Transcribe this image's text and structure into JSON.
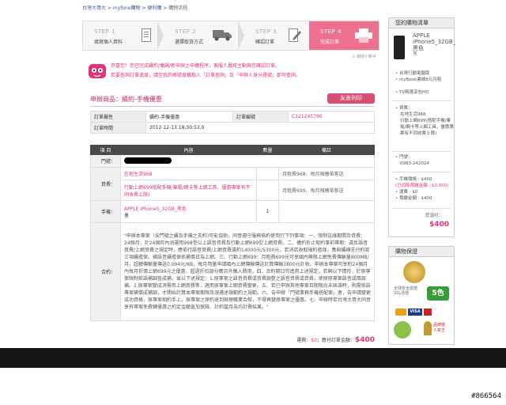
{
  "breadcrumb": {
    "home": "台灣大哥大",
    "myfone": "myfone購物",
    "shopping": "便利購",
    "current": "購物流程",
    "sep": " > "
  },
  "steps": [
    {
      "num": "STEP 1",
      "label": "填寫個人資料"
    },
    {
      "num": "STEP 2",
      "label": "選擇取貨方式"
    },
    {
      "num": "STEP 3",
      "label": "確認訂單"
    },
    {
      "num": "STEP 4",
      "label": "完成訂單"
    }
  ],
  "confirm": {
    "line1": "恭喜您！您已完成續約/攜碼/新申辦之申購程序，客服人員將主動與您確認訂單。",
    "line2": "若要查詢訂單進度，請至我的帳號頁籤點入「訂單查詢」及「申辦人身分證號」即可查詢。",
    "close": "關閉小幫手"
  },
  "apply": {
    "title": "申辦商品：續約-手機優惠",
    "print": "友善列印"
  },
  "info": {
    "type_label": "訂單屬性",
    "type_value": "續約-手機優惠",
    "num_label": "訂單編號",
    "num_value": "C121245796",
    "time_label": "訂單時間",
    "time_value": "2012-12-13 18:30:53.0"
  },
  "detail": {
    "headers": [
      "項 目",
      "內容",
      "數量",
      "備註"
    ],
    "door_label": "門號：",
    "fee_label": "資費：",
    "fee_plan1": "在地生活968",
    "fee_note1": "月租費968、每月預繳單客送",
    "fee_plan2": "行動上網699搭配手機/筆電/網卡等上網工具，優惠專案有不同收費上限)",
    "fee_note2": "月租費699、每月預繳單客送",
    "phone_label": "手機：",
    "phone_name": "APPLE iPhone5_32GB_黑色",
    "phone_color": "黑",
    "phone_qty": "1",
    "contract_label": "合約：",
    "contract_text": "\"申辦本專案（含門號之續及手機之支約)可能協助，同意遵守服務條約使用行下列事項：一、限制這綠期間及資費：24個月；計24個月內消運用968型以上語音資費及行動上網699型上網資費。二、權約折止契約事前專期：違反語音資費/上網資費之規定時，應依行語音資費/上網資費違約14000元/5300元，若消店收取綠約擔保，應與續補支付約款三項續擔保。補語音續擔保依補償日為上網。三、行動上網699：月租費699元可享國內無限上網免費傳輸量800MB/月，超額傳輸量傳送0.004元/KB，每月用量申請國內上網傳輸傳送計算傳輸1800元計收。申辦本專案可享約24個月內每月折價上網699元之優惠，超過折扣部分應另外繳入費用，四、合約期日完進用上述規定，若無以下情形，於原專案限制依語補調查成補，並以下述規定：1.原專案之語音資費或資費調整之語音資費或資費，使原原專案語音或價調補。2.原專案變成消需用上網資費等，適用原專案上網資費變更。五、若已申辦其他專案且期限尚未屆滿時，則需依該專案補償成補調，才開始計算本專案期限及須遵述規範約之規範。六、告申辦「門號業務手機搭配案」者，告申請變更成功資格，原專案相約手上，原專案之原約退到辦理職業合館，不得再變原專案之優惠。七、申辦時若台灣大哥大同意享有專案免費轉優惠之約定金額直加保險、計約當月為均計費結果。\""
  },
  "total": {
    "fee_label": "運費：",
    "fee": "$0",
    "order_label": "；應付訂單金額：",
    "amount": "$400"
  },
  "cart": {
    "title": "您的購物清單",
    "phone_name": "APPLE iPhone5_32GB_黑色",
    "phone_color": "黑",
    "gifts": [
      "台灣行動電腦版",
      "myBook書城8元月租",
      "TV精選享包HD"
    ],
    "plan_label": "資費：",
    "plan1": "在地生活968",
    "plan2": "行動上網699(搭配手機/筆電/網卡等上網工具，優惠專案有不同收費上限)",
    "door_label": "門號：",
    "door": "0983-242024",
    "phone_price_label": "手機價格",
    "phone_price": "$400",
    "discount_label": "(已扣除預繳金額",
    "discount": "$3,000)",
    "ship_label": "運費",
    "ship": "$0",
    "prepaid_label": "預繳金額",
    "prepaid": "$400",
    "total_label": "您須付：",
    "total": "$400"
  },
  "guarantee": {
    "title": "購物保證",
    "cert": "全球安全認證",
    "cert2": "SSL憑證",
    "visa": "VISA",
    "mastercard": "MasterCard",
    "badge": "5色",
    "extra1": "品牌號",
    "extra2": "人氣王"
  },
  "watermark": "#866564",
  "colors": {
    "accent": "#e3317a",
    "step_active": "#ef6f8f",
    "band": "#151515"
  }
}
